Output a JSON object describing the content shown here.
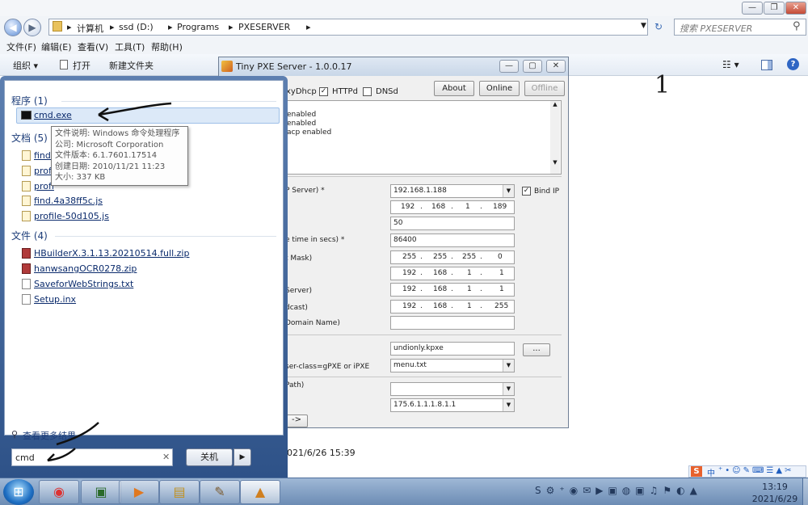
{
  "explorer": {
    "breadcrumb": [
      "计算机",
      "ssd (D:)",
      "Programs",
      "PXESERVER"
    ],
    "search_placeholder": "搜索 PXESERVER",
    "menu": [
      "文件(F)",
      "编辑(E)",
      "查看(V)",
      "工具(T)",
      "帮助(H)"
    ],
    "toolbar": {
      "organize": "组织 ▾",
      "open": "打开",
      "new_folder": "新建文件夹"
    },
    "window_buttons": [
      "—",
      "❐",
      "✕"
    ]
  },
  "pxe": {
    "title": "Tiny PXE Server - 1.0.0.17",
    "options": [
      "xyDhcp",
      "HTTPd",
      "DNSd"
    ],
    "buttons": {
      "about": "About",
      "online": "Online",
      "offline": "Offline"
    },
    "log": [
      "enabled",
      "enabled",
      "acp enabled"
    ],
    "bind_ip_label": "Bind IP",
    "rows": [
      {
        "label": "P Server) *",
        "value": "192.168.1.188",
        "type": "dropdown"
      },
      {
        "label": "",
        "ip": [
          "192",
          "168",
          "1",
          "189"
        ],
        "type": "ip"
      },
      {
        "label": "",
        "value": "50",
        "type": "text"
      },
      {
        "label": "e time in secs) *",
        "value": "86400",
        "type": "text"
      },
      {
        "label": "t Mask)",
        "ip": [
          "255",
          "255",
          "255",
          "0"
        ],
        "type": "ip"
      },
      {
        "label": ")",
        "ip": [
          "192",
          "168",
          "1",
          "1"
        ],
        "type": "ip"
      },
      {
        "label": "Server)",
        "ip": [
          "192",
          "168",
          "1",
          "1"
        ],
        "type": "ip"
      },
      {
        "label": "dcast)",
        "ip": [
          "192",
          "168",
          "1",
          "255"
        ],
        "type": "ip"
      },
      {
        "label": "Domain Name)",
        "value": "",
        "type": "text"
      }
    ],
    "boot_file": "undionly.kpxe",
    "browse_label": "...",
    "user_class_label": "ser-class=gPXE or iPXE",
    "menu_file": "menu.txt",
    "path_label": "Path)",
    "path_value": "",
    "opt_value": "175.6.1.1.1.8.1.1",
    "arrow_button": "->",
    "status_date": "021/6/26 15:39"
  },
  "annotations": {
    "number": "1"
  },
  "startmenu": {
    "sections": [
      {
        "title": "程序 (1)",
        "items": [
          "cmd.exe"
        ]
      },
      {
        "title": "文档 (5)",
        "items": [
          "find.",
          "profi",
          "profi",
          "find.4a38ff5c.js",
          "profile-50d105.js"
        ]
      },
      {
        "title": "文件 (4)",
        "items": [
          "HBuilderX.3.1.13.20210514.full.zip",
          "hanwsangOCR0278.zip",
          "SaveforWebStrings.txt",
          "Setup.inx"
        ]
      }
    ],
    "tooltip": [
      "文件说明: Windows 命令处理程序",
      "公司: Microsoft Corporation",
      "文件版本: 6.1.7601.17514",
      "创建日期: 2010/11/21 11:23",
      "大小: 337 KB"
    ],
    "see_more": "查看更多结果",
    "search_value": "cmd",
    "shutdown_label": "关机"
  },
  "taskbar": {
    "time": "13:19",
    "date": "2021/6/29",
    "ime": "中"
  }
}
